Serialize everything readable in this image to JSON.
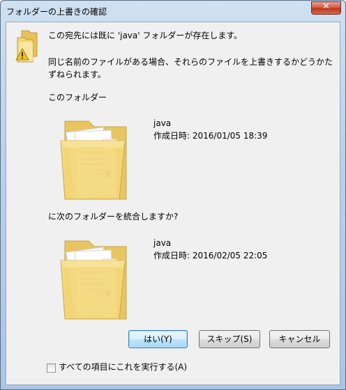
{
  "window": {
    "title": "フォルダーの上書きの確認",
    "close_symbol": "✕"
  },
  "message": {
    "line1": "この宛先には既に 'java' フォルダーが存在します。",
    "line2": "同じ名前のファイルがある場合、それらのファイルを上書きするかどうかた",
    "line3": "ずねられます。"
  },
  "existing": {
    "heading": "このフォルダー",
    "name": "java",
    "date": "作成日時: 2016/01/05 18:39",
    "icon": "folder-icon"
  },
  "incoming": {
    "heading": "に次のフォルダーを統合しますか?",
    "name": "java",
    "date": "作成日時: 2016/02/05 22:05",
    "icon": "folder-icon"
  },
  "buttons": {
    "yes": "はい(Y)",
    "skip": "スキップ(S)",
    "cancel": "キャンセル"
  },
  "apply_all": {
    "label": "すべての項目にこれを実行する(A)",
    "checked": false
  },
  "colors": {
    "accent": "#3c7fb1",
    "title_bar": "#b9d1ea",
    "close": "#c8432c",
    "folder": "#f2cf6e"
  }
}
